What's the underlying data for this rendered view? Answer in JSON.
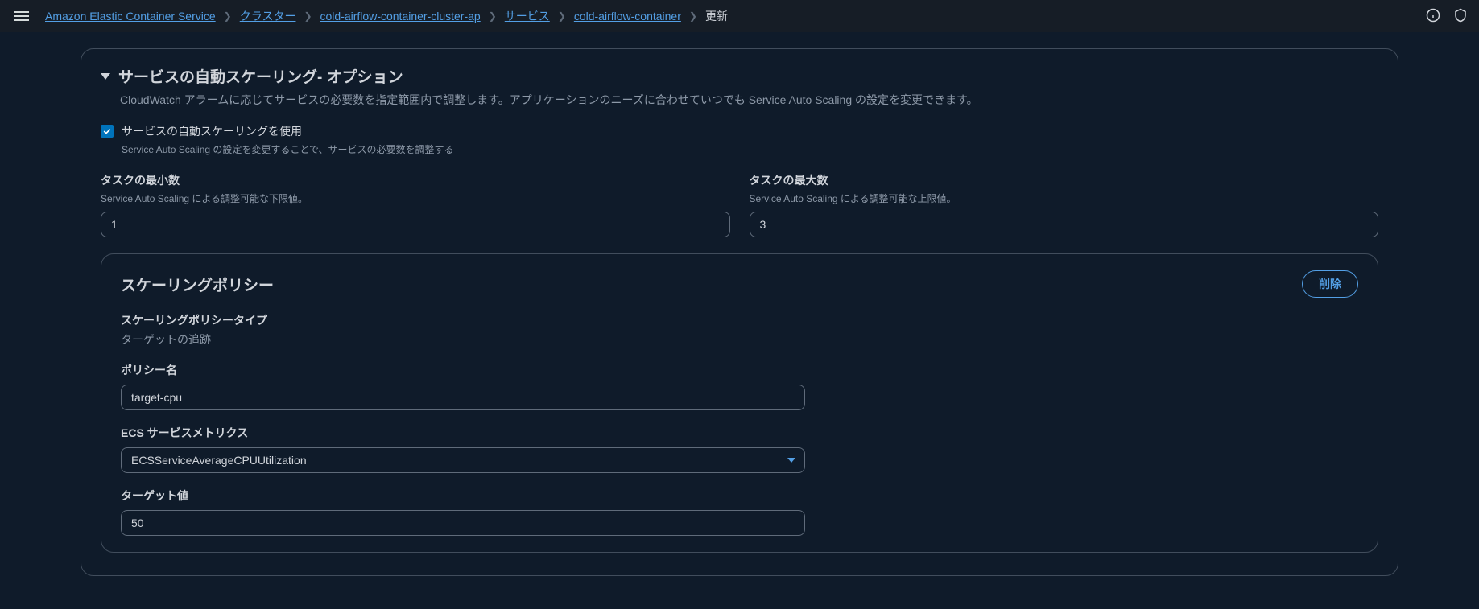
{
  "breadcrumbs": {
    "items": [
      {
        "label": "Amazon Elastic Container Service",
        "link": true
      },
      {
        "label": "クラスター",
        "link": true
      },
      {
        "label": "cold-airflow-container-cluster-ap",
        "link": true
      },
      {
        "label": "サービス",
        "link": true
      },
      {
        "label": "cold-airflow-container",
        "link": true
      },
      {
        "label": "更新",
        "link": false
      }
    ]
  },
  "section": {
    "title_main": "サービスの自動スケーリング",
    "title_suffix": "- オプション",
    "description": "CloudWatch アラームに応じてサービスの必要数を指定範囲内で調整します。アプリケーションのニーズに合わせていつでも Service Auto Scaling の設定を変更できます。"
  },
  "checkbox": {
    "label": "サービスの自動スケーリングを使用",
    "hint": "Service Auto Scaling の設定を変更することで、サービスの必要数を調整する",
    "checked": true
  },
  "min_tasks": {
    "label": "タスクの最小数",
    "hint": "Service Auto Scaling による調整可能な下限値。",
    "value": "1"
  },
  "max_tasks": {
    "label": "タスクの最大数",
    "hint": "Service Auto Scaling による調整可能な上限値。",
    "value": "3"
  },
  "policy": {
    "title": "スケーリングポリシー",
    "delete_label": "削除",
    "type_label": "スケーリングポリシータイプ",
    "type_value": "ターゲットの追跡",
    "name_label": "ポリシー名",
    "name_value": "target-cpu",
    "metric_label": "ECS サービスメトリクス",
    "metric_value": "ECSServiceAverageCPUUtilization",
    "target_label": "ターゲット値",
    "target_value": "50"
  }
}
